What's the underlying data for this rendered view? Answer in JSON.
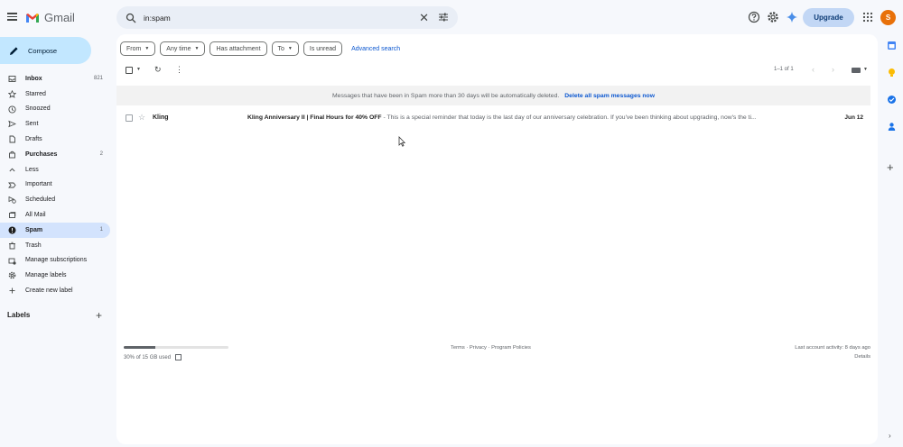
{
  "app": {
    "name": "Gmail"
  },
  "header": {
    "search_value": "in:spam",
    "upgrade_label": "Upgrade",
    "avatar_letter": "S",
    "icons": [
      "menu-icon",
      "search-icon",
      "clear-icon",
      "tune-icon",
      "help-icon",
      "settings-icon",
      "gemini-icon",
      "apps-icon"
    ]
  },
  "sidebar": {
    "compose_label": "Compose",
    "items": [
      {
        "label": "Inbox",
        "count": "821",
        "icon": "inbox-icon",
        "bold": true
      },
      {
        "label": "Starred",
        "count": "",
        "icon": "star-icon"
      },
      {
        "label": "Snoozed",
        "count": "",
        "icon": "clock-icon"
      },
      {
        "label": "Sent",
        "count": "",
        "icon": "send-icon"
      },
      {
        "label": "Drafts",
        "count": "",
        "icon": "draft-icon"
      },
      {
        "label": "Purchases",
        "count": "2",
        "icon": "bag-icon",
        "bold": true
      },
      {
        "label": "Less",
        "count": "",
        "icon": "chevron-up-icon"
      },
      {
        "label": "Important",
        "count": "",
        "icon": "important-icon"
      },
      {
        "label": "Scheduled",
        "count": "",
        "icon": "scheduled-icon"
      },
      {
        "label": "All Mail",
        "count": "",
        "icon": "all-mail-icon"
      },
      {
        "label": "Spam",
        "count": "1",
        "icon": "spam-icon",
        "active": true
      },
      {
        "label": "Trash",
        "count": "",
        "icon": "trash-icon"
      },
      {
        "label": "Manage subscriptions",
        "count": "",
        "icon": "subscriptions-icon"
      },
      {
        "label": "Manage labels",
        "count": "",
        "icon": "gear-icon"
      },
      {
        "label": "Create new label",
        "count": "",
        "icon": "plus-icon"
      }
    ],
    "labels_heading": "Labels"
  },
  "filters": {
    "chips": [
      "From",
      "Any time",
      "Has attachment",
      "To",
      "Is unread"
    ],
    "chips_with_caret": [
      true,
      true,
      false,
      true,
      false
    ],
    "advanced_search": "Advanced search"
  },
  "toolbar": {
    "range": "1–1 of 1"
  },
  "banner": {
    "text": "Messages that have been in Spam more than 30 days will be automatically deleted.",
    "link": "Delete all spam messages now"
  },
  "emails": [
    {
      "sender": "Kling",
      "subject": "Kling Anniversary II | Final Hours for 40% OFF",
      "snippet": " - This is a special reminder that today is the last day of our anniversary celebration. If you've been thinking about upgrading, now's the ti...",
      "date": "Jun 12"
    }
  ],
  "footer": {
    "storage_text": "30% of 15 GB used",
    "storage_fraction": 0.3,
    "links": "Terms · Privacy · Program Policies",
    "activity": "Last account activity: 8 days ago",
    "details": "Details"
  },
  "colors": {
    "brand_red": "#ea4335",
    "accent_blue": "#0b57d0",
    "active_bg": "#d3e3fd",
    "compose_bg": "#c2e7ff",
    "avatar": "#e8710a"
  }
}
